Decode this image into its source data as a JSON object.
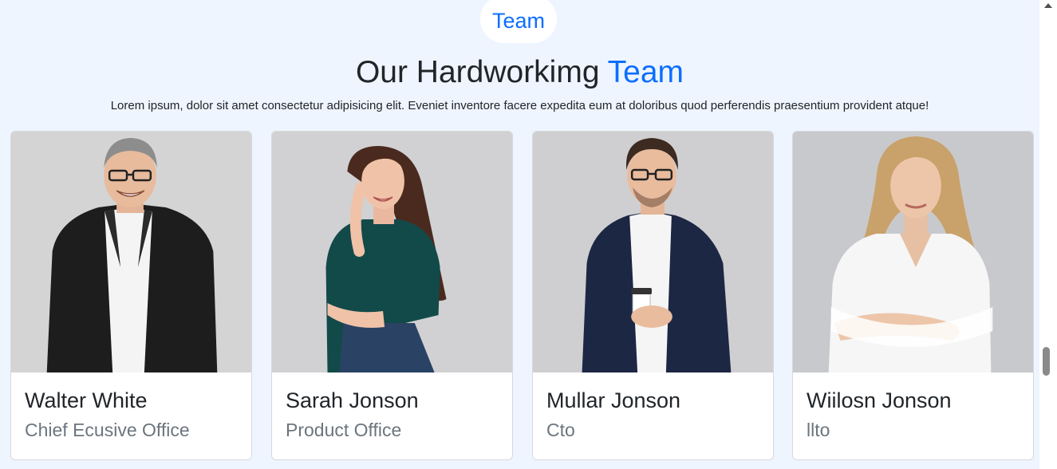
{
  "section": {
    "badge": "Team",
    "heading_prefix": "Our Hardworkimg",
    "heading_accent": "Team",
    "subtitle": "Lorem ipsum, dolor sit amet consectetur adipisicing elit. Eveniet inventore facere expedita eum at doloribus quod perferendis praesentium provident atque!"
  },
  "team": [
    {
      "name": "Walter White",
      "role": "Chief Ecusive Office"
    },
    {
      "name": "Sarah Jonson",
      "role": "Product Office"
    },
    {
      "name": "Mullar Jonson",
      "role": "Cto"
    },
    {
      "name": "Wiilosn Jonson",
      "role": "llto"
    }
  ],
  "colors": {
    "accent": "#0d6efd",
    "background": "#eef5ff",
    "muted_text": "#6c757d"
  }
}
